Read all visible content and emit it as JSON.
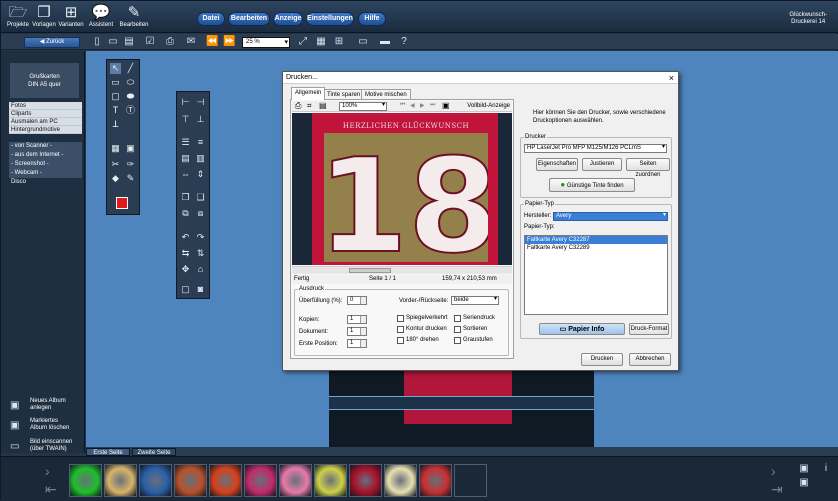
{
  "app": {
    "title_line1": "Glückwunsch-",
    "title_line2": "Druckerei 14"
  },
  "top_tools": [
    {
      "label": "Projekte",
      "icon": "folder-icon"
    },
    {
      "label": "Vorlagen",
      "icon": "documents-icon"
    },
    {
      "label": "Varianten",
      "icon": "grid-icon"
    },
    {
      "label": "Assistent",
      "icon": "chat-icon"
    },
    {
      "label": "Bearbeiten",
      "icon": "pencil-icon"
    }
  ],
  "menu": [
    "Datei",
    "Bearbeiten",
    "Anzeige",
    "Einstellungen",
    "Hilfe"
  ],
  "toolbar2": {
    "back_label": "Zurück",
    "zoom": "25 %"
  },
  "sidebar": {
    "format_line1": "Grußkarten",
    "format_line2": "DIN A5 quer",
    "categories": [
      "Fotos",
      "Cliparts",
      "Ausmalen am PC",
      "Hintergrundmotive"
    ],
    "sources": [
      "- von Scanner -",
      "- aus dem Internet -",
      "- Screenshot -",
      "- Webcam -"
    ],
    "extra": "Disco",
    "actions": [
      {
        "line1": "Neues Album",
        "line2": "anlegen"
      },
      {
        "line1": "Markiertes",
        "line2": "Album löschen"
      },
      {
        "line1": "Bild einscannen",
        "line2": "(über TWAIN)"
      }
    ]
  },
  "page_tabs": [
    "Erste Seite",
    "Zweite Seite"
  ],
  "thumb_colors": [
    "#1fbf2a",
    "#d8b46a",
    "#2a5fa8",
    "#b9502a",
    "#d8401a",
    "#c22a6a",
    "#e87aa8",
    "#cfd04a",
    "#a8102a",
    "#e8e0b0",
    "#c83030"
  ],
  "dialog": {
    "title": "Drucken...",
    "close": "×",
    "tabs": [
      "Allgemein",
      "Tinte sparen",
      "Motive mischen"
    ],
    "preview_zoom": "100%",
    "vollbild": "Vollbild-Anzeige",
    "card_header": "HERZLICHEN GLÜCKWUNSCH",
    "card_number": "18",
    "status": {
      "state": "Fertig",
      "page": "Seite 1 / 1",
      "size": "159,74 x 210,53 mm"
    },
    "info_text": "Hier können Sie den Drucker, sowie verschiedene Druckoptionen auswählen.",
    "drucker_legend": "Drucker",
    "printer": "HP LaserJet Pro MFP M125/M126 PCLmS",
    "btn_eigenschaften": "Eigenschaften",
    "btn_justieren": "Justieren",
    "btn_seiten": "Seiten zuordnen",
    "btn_tinte": "Günstige Tinte finden",
    "papier_legend": "Papier-Typ",
    "hersteller_label": "Hersteller:",
    "hersteller_value": "Avery",
    "papiertyp_label": "Papier-Typ:",
    "paper_items": [
      "Faltkarte Avery C32287",
      "Faltkarte Avery C32289"
    ],
    "btn_papier_info": "Papier Info",
    "btn_druckformat": "Druck-Format",
    "ausdruck_legend": "Ausdruck",
    "ueberfuellung_label": "Überfüllung (%):",
    "ueberfuellung_value": "0",
    "kopien_label": "Kopien:",
    "kopien_value": "1",
    "dokument_label": "Dokument:",
    "dokument_value": "1",
    "erste_pos_label": "Erste Position:",
    "erste_pos_value": "1",
    "vorder_label": "Vorder-/Rückseite:",
    "vorder_value": "beide",
    "checkboxes": [
      "Spiegelverkehrt",
      "Kontur drucken",
      "180° drehen",
      "Seriendruck",
      "Sortieren",
      "Graustufen"
    ],
    "btn_drucken": "Drucken",
    "btn_abbrechen": "Abbrechen"
  }
}
